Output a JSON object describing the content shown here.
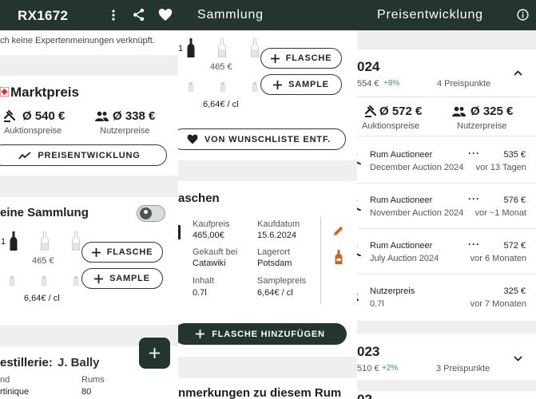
{
  "panel1": {
    "header": {
      "logo": "RX1672",
      "menu_icon": "more-vert-icon",
      "share_icon": "share-icon",
      "favorite_icon": "heart-icon"
    },
    "no_expert_text": "ch keine Expertenmeinungen verknüpft.",
    "market": {
      "title": "Marktpreis",
      "auction_value": "Ø 540 €",
      "auction_label": "Auktionspreise",
      "user_value": "Ø 338 €",
      "user_label": "Nutzerpreise",
      "button": "PREISENTWICKLUNG"
    },
    "collection": {
      "title": "eine Sammlung",
      "count": "1",
      "bottle_price": "465 €",
      "sample_price": "6,64€ / cl",
      "btn_bottle": "FLASCHE",
      "btn_sample": "SAMPLE"
    },
    "distillery": {
      "label": "estillerie:",
      "name": "J. Bally",
      "col1_label": "nd",
      "col1_value": "rtinique",
      "col2_label": "Rums",
      "col2_value": "80"
    },
    "fab_icon": "plus-icon"
  },
  "panel2": {
    "header": {
      "title": "Sammlung"
    },
    "count": "1",
    "bottle_price": "465 €",
    "sample_price": "6,64€ / cl",
    "btn_bottle": "FLASCHE",
    "btn_sample": "SAMPLE",
    "wishlist_button": "VON WUNSCHLISTE ENTF.",
    "bottles_title": "aschen",
    "details": {
      "kaufpreis_label": "Kaufpreis",
      "kaufpreis": "465,00€",
      "kaufdatum_label": "Kaufdatum",
      "kaufdatum": "15.6.2024",
      "gekauft_label": "Gekauft bei",
      "gekauft": "Catawiki",
      "lagerort_label": "Lagerort",
      "lagerort": "Potsdam",
      "inhalt_label": "Inhalt",
      "inhalt": "0.7l",
      "samplepreis_label": "Samplepreis",
      "samplepreis": "6,64€ / cl"
    },
    "add_bottle_button": "FLASCHE HINZUFÜGEN",
    "notes_title": "nmerkungen zu diesem Rum"
  },
  "panel3": {
    "header": {
      "title": "Preisentwicklung",
      "info_icon": "info-icon"
    },
    "year2024": {
      "year": "024",
      "avg": "554 €",
      "change": "+8%",
      "points": "4 Preispunkte"
    },
    "auction_value": "Ø 572 €",
    "auction_label": "Auktionspreise",
    "user_value": "Ø 325 €",
    "user_label": "Nutzerpreise",
    "entries": [
      {
        "title": "Rum Auctioneer",
        "subtitle": "December Auction 2024",
        "price": "535 €",
        "ago": "vor 13 Tagen"
      },
      {
        "title": "Rum Auctioneer",
        "subtitle": "November Auction 2024",
        "price": "576 €",
        "ago": "vor ~1 Monat"
      },
      {
        "title": "Rum Auctioneer",
        "subtitle": "July Auction 2024",
        "price": "572 €",
        "ago": "vor 6 Monaten"
      },
      {
        "title": "Nutzerpreis",
        "subtitle": "0.7l",
        "price": "325 €",
        "ago": "vor 7 Monaten"
      }
    ],
    "year2023": {
      "year": "023",
      "avg": "510 €",
      "change": "+2%",
      "points": "3 Preispunkte"
    },
    "year2022_partial": "02"
  },
  "colors": {
    "header_bg": "#24342f",
    "positive": "#3c9a5a",
    "section_gray": "#eef0f0",
    "pen": "#c8692a"
  }
}
